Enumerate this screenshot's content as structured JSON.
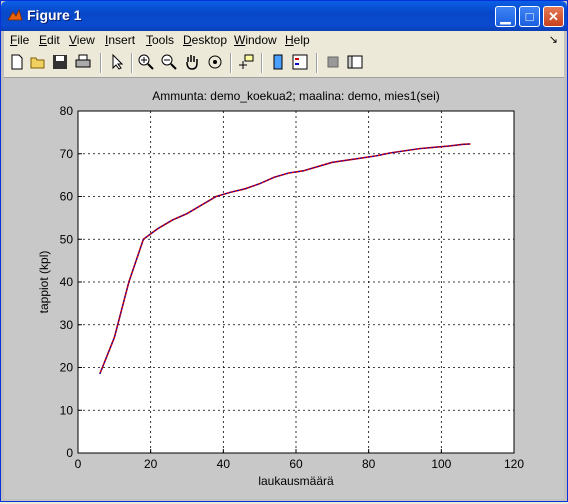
{
  "window": {
    "title": "Figure 1"
  },
  "menu": [
    "File",
    "Edit",
    "View",
    "Insert",
    "Tools",
    "Desktop",
    "Window",
    "Help"
  ],
  "menu_underline": [
    "F",
    "E",
    "V",
    "I",
    "T",
    "D",
    "W",
    "H"
  ],
  "toolbar_icons": [
    "new-icon",
    "open-icon",
    "save-icon",
    "print-icon",
    "pointer-icon",
    "zoom-in-icon",
    "zoom-out-icon",
    "pan-icon",
    "rotate-icon",
    "data-cursor-icon",
    "colorbar-icon",
    "legend-icon",
    "hide-plot-tools-icon",
    "show-plot-tools-icon"
  ],
  "chart_data": {
    "type": "line",
    "title": "Ammunta: demo_koekua2; maalina: demo, mies1(sei)",
    "xlabel": "laukausmäärä",
    "ylabel": "tappiot (kpl)",
    "xlim": [
      0,
      120
    ],
    "ylim": [
      0,
      80
    ],
    "xticks": [
      0,
      20,
      40,
      60,
      80,
      100,
      120
    ],
    "yticks": [
      0,
      10,
      20,
      30,
      40,
      50,
      60,
      70,
      80
    ],
    "grid": true,
    "series": [
      {
        "color": "#cc0000",
        "overlay_color": "#0000cc",
        "x": [
          6,
          10,
          14,
          18,
          22,
          26,
          30,
          34,
          38,
          42,
          46,
          50,
          54,
          58,
          62,
          66,
          70,
          74,
          78,
          82,
          86,
          90,
          94,
          98,
          102,
          106,
          108
        ],
        "y": [
          18.5,
          27,
          40,
          50,
          52.5,
          54.5,
          56,
          58,
          60,
          61,
          61.8,
          63,
          64.5,
          65.5,
          66,
          67,
          68,
          68.5,
          69,
          69.5,
          70.2,
          70.7,
          71.2,
          71.5,
          71.8,
          72.2,
          72.3
        ]
      }
    ]
  }
}
